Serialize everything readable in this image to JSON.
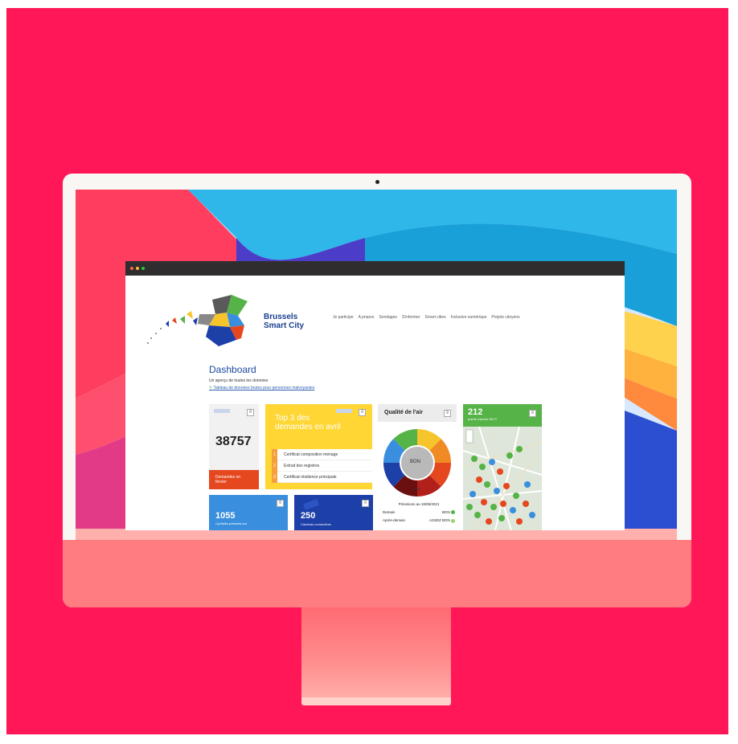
{
  "colors": {
    "background": "#ff1758",
    "brand": "#1b3f8f",
    "accent_red": "#e5471f",
    "accent_yellow": "#ffd634",
    "accent_green": "#55b347",
    "accent_blue": "#3a8ede",
    "accent_navy": "#1d3fa8"
  },
  "site": {
    "brand_line1": "Brussels",
    "brand_line2": "Smart City",
    "nav": [
      "Je participe",
      "A propos",
      "Sondages",
      "S'informer",
      "Smart cities",
      "Inclusion numérique",
      "Projets citoyens"
    ]
  },
  "dashboard": {
    "title": "Dashboard",
    "subtitle": "Un aperçu de toutes les données",
    "link": "Tableau de données brutes pour personnes malvoyantes"
  },
  "cards": {
    "demandes": {
      "value": "38757",
      "label": "Demandes en février"
    },
    "top3": {
      "title": "Top 3 des demandes en avril",
      "items": [
        {
          "n": "1",
          "label": "Certificat composition ménage"
        },
        {
          "n": "2",
          "label": "Extrait des registres"
        },
        {
          "n": "3",
          "label": "Certificat résidence principale"
        }
      ]
    },
    "air": {
      "title": "Qualité de l'air",
      "status": "BON",
      "date": "18/05",
      "forecast_title": "Prévisions au 18/05/2021",
      "forecast": [
        {
          "day": "Demain",
          "value": "BON"
        },
        {
          "day": "Après-demain",
          "value": "ASSEZ BON"
        }
      ]
    },
    "wifi": {
      "value": "212",
      "label": "points d'accès Wi-Fi"
    },
    "cyclists": {
      "value": "1055",
      "label": "Cyclistes présents sur"
    },
    "cameras": {
      "value": "250",
      "label": "Caméras connectées"
    }
  },
  "icons": {
    "download": "download-icon"
  },
  "dl_glyph": "⇩"
}
